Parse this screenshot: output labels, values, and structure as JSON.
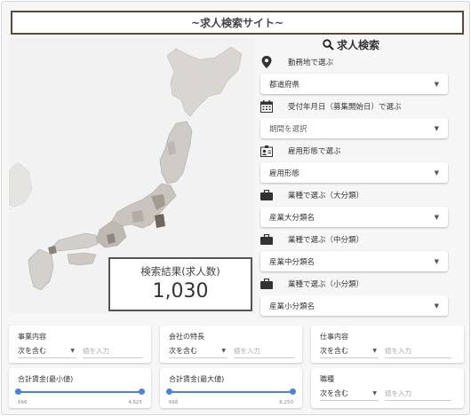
{
  "header": {
    "title": "~求人検索サイト~"
  },
  "results": {
    "label": "検索結果(求人数)",
    "count": "1,030"
  },
  "search": {
    "heading": "求人検索",
    "filters": [
      {
        "icon": "map-pin-icon",
        "label": "勤務地で選ぶ",
        "value": "都道府県",
        "placeholder": false
      },
      {
        "icon": "calendar-icon",
        "label": "受付年月日（募集開始日）で選ぶ",
        "value": "期間を選択",
        "placeholder": true
      },
      {
        "icon": "id-badge-icon",
        "label": "雇用形態で選ぶ",
        "value": "雇用形態",
        "placeholder": false
      },
      {
        "icon": "briefcase-icon",
        "label": "業種で選ぶ（大分類）",
        "value": "産業大分類名",
        "placeholder": false
      },
      {
        "icon": "briefcase-icon",
        "label": "業種で選ぶ（中分類）",
        "value": "産業中分類名",
        "placeholder": false
      },
      {
        "icon": "briefcase-icon",
        "label": "業種で選ぶ（小分類）",
        "value": "産業小分類名",
        "placeholder": false
      }
    ]
  },
  "text_filters": [
    {
      "label": "事業内容",
      "operator": "次を含む",
      "placeholder": "値を入力"
    },
    {
      "label": "会社の特長",
      "operator": "次を含む",
      "placeholder": "値を入力"
    },
    {
      "label": "仕事内容",
      "operator": "次を含む",
      "placeholder": "値を入力"
    },
    {
      "label": "職種",
      "operator": "次を含む",
      "placeholder": "値を入力"
    }
  ],
  "range_filters": [
    {
      "label": "合計賃金(最小値)",
      "min": "666",
      "max": "4,625"
    },
    {
      "label": "合計賃金(最大値)",
      "min": "666",
      "max": "6,250"
    }
  ],
  "colors": {
    "frame_border": "#5b4a3a",
    "slider": "#4a80e0",
    "map_land": "#d6d3cf",
    "map_sea": "#f2f2f2"
  }
}
